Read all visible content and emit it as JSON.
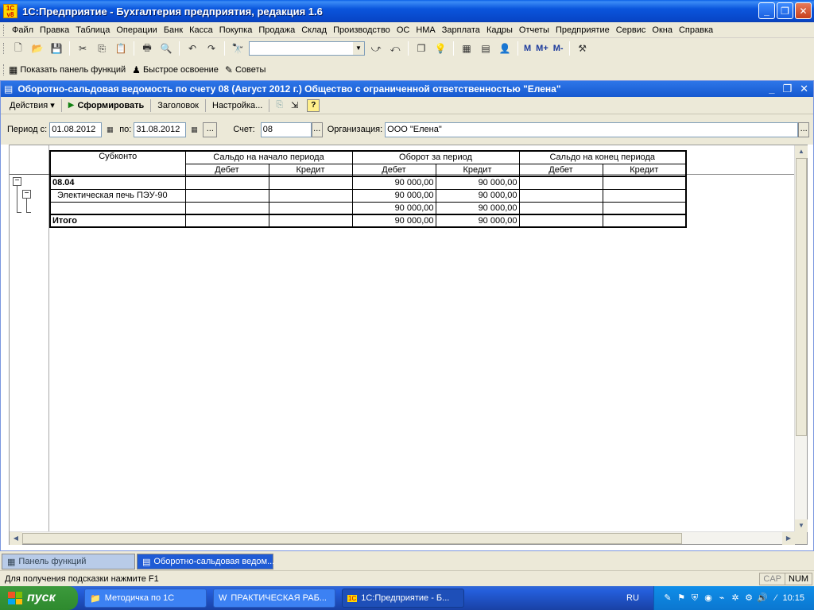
{
  "window": {
    "logo": "1C\nv8",
    "title": "1С:Предприятие - Бухгалтерия предприятия, редакция 1.6",
    "minimize": "_",
    "maximize": "❐",
    "close": "✕"
  },
  "menu": {
    "items": [
      "Файл",
      "Правка",
      "Таблица",
      "Операции",
      "Банк",
      "Касса",
      "Покупка",
      "Продажа",
      "Склад",
      "Производство",
      "ОС",
      "НМА",
      "Зарплата",
      "Кадры",
      "Отчеты",
      "Предприятие",
      "Сервис",
      "Окна",
      "Справка"
    ]
  },
  "toolbar": {
    "m_buttons": [
      "M",
      "M+",
      "M-"
    ]
  },
  "toolbar2": {
    "show_panel": "Показать панель функций",
    "quick_start": "Быстрое освоение",
    "tips": "Советы"
  },
  "doc": {
    "title": "Оборотно-сальдовая ведомость по счету 08 (Август 2012 г.) Общество с ограниченной ответственностью \"Елена\"",
    "actions": "Действия",
    "generate": "Сформировать",
    "header_btn": "Заголовок",
    "settings_btn": "Настройка...",
    "help": "?"
  },
  "params": {
    "period_from_label": "Период с:",
    "period_from": "01.08.2012",
    "period_to_label": "по:",
    "period_to": "31.08.2012",
    "account_label": "Счет:",
    "account": "08",
    "org_label": "Организация:",
    "org": "ООО \"Елена\"",
    "dots": "..."
  },
  "report": {
    "headers": {
      "subkonto": "Субконто",
      "opening": "Сальдо на начало периода",
      "turnover": "Оборот за период",
      "closing": "Сальдо на конец периода",
      "debit": "Дебет",
      "credit": "Кредит"
    },
    "rows": [
      {
        "name": "08.04",
        "od": "",
        "oc": "",
        "td": "90 000,00",
        "tc": "90 000,00",
        "cd": "",
        "cc": "",
        "bold": true
      },
      {
        "name": "Электическая печь ПЭУ-90",
        "od": "",
        "oc": "",
        "td": "90 000,00",
        "tc": "90 000,00",
        "cd": "",
        "cc": "",
        "bold": false
      },
      {
        "name": "",
        "od": "",
        "oc": "",
        "td": "90 000,00",
        "tc": "90 000,00",
        "cd": "",
        "cc": "",
        "bold": false
      }
    ],
    "total": {
      "name": "Итого",
      "od": "",
      "oc": "",
      "td": "90 000,00",
      "tc": "90 000,00",
      "cd": "",
      "cc": ""
    }
  },
  "wintabs": {
    "panel": "Панель функций",
    "report": "Оборотно-сальдовая ведом..."
  },
  "status": {
    "hint": "Для получения подсказки нажмите F1",
    "cap": "CAP",
    "num": "NUM"
  },
  "taskbar": {
    "start": "пуск",
    "tasks": [
      "Методичка по 1С",
      "ПРАКТИЧЕСКАЯ РАБ...",
      "1С:Предприятие - Б..."
    ],
    "lang": "RU",
    "clock": "10:15"
  }
}
